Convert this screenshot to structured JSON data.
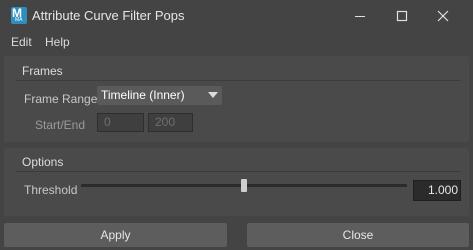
{
  "window": {
    "title": "Attribute Curve Filter Pops",
    "app_icon_letter": "M",
    "app_icon_sub": "MA"
  },
  "menu": {
    "items": [
      "Edit",
      "Help"
    ]
  },
  "frames": {
    "section_label": "Frames",
    "frame_range_label": "Frame Range",
    "frame_range_value": "Timeline (Inner)",
    "start_end_label": "Start/End",
    "start_value": "0",
    "end_value": "200"
  },
  "options": {
    "section_label": "Options",
    "threshold_label": "Threshold",
    "threshold_value": "1.000",
    "threshold_slider_fraction": 0.5
  },
  "buttons": {
    "apply": "Apply",
    "close": "Close"
  },
  "colors": {
    "background": "#444444",
    "group": "#4a4a4a",
    "button": "#5d5d5d",
    "app_icon": "#2e8fbd"
  }
}
